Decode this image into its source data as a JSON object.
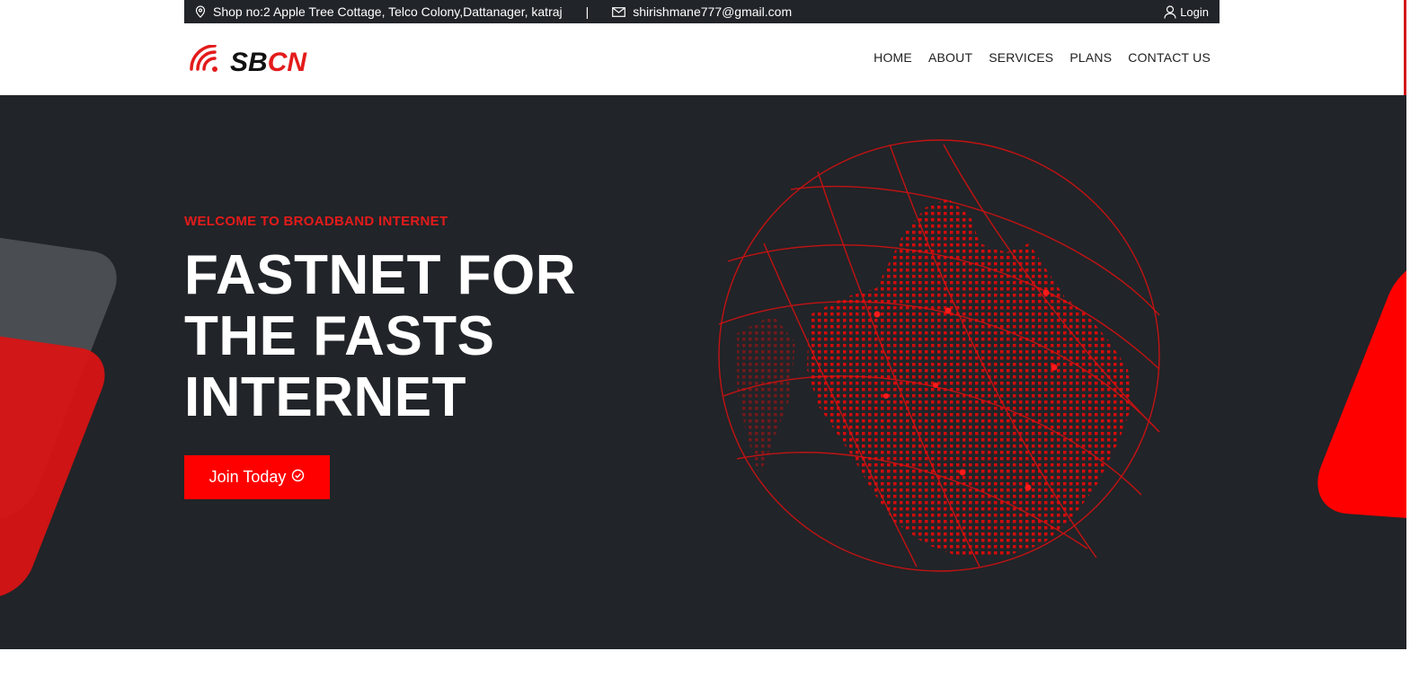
{
  "topbar": {
    "address": "Shop no:2 Apple Tree Cottage, Telco Colony,Dattanager, katraj",
    "separator": "|",
    "email": "shirishmane777@gmail.com",
    "login_label": "Login",
    "location_icon": "map-pin-icon",
    "email_icon": "envelope-icon",
    "user_icon": "user-icon"
  },
  "logo": {
    "part1": "SB",
    "part2": "CN",
    "icon": "wifi-signal-icon"
  },
  "nav": {
    "items": [
      {
        "label": "HOME"
      },
      {
        "label": "ABOUT"
      },
      {
        "label": "SERVICES"
      },
      {
        "label": "PLANS"
      },
      {
        "label": "CONTACT US"
      }
    ]
  },
  "hero": {
    "eyebrow": "WELCOME TO BROADBAND INTERNET",
    "headline_line1": "FASTNET FOR",
    "headline_line2": "THE FASTS",
    "headline_line3": "INTERNET",
    "cta_label": "Join Today",
    "cta_icon": "check-circle-icon"
  },
  "colors": {
    "accent": "#ff0000",
    "dark": "#212428",
    "white": "#ffffff"
  }
}
